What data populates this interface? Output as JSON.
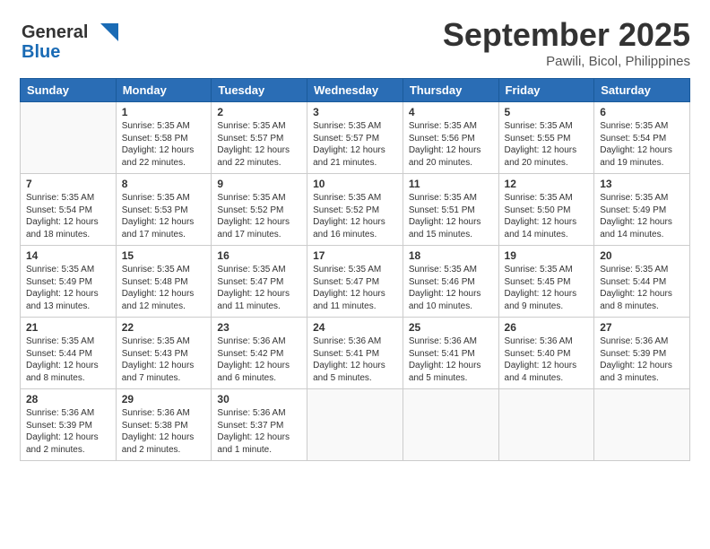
{
  "header": {
    "logo_general": "General",
    "logo_blue": "Blue",
    "main_title": "September 2025",
    "subtitle": "Pawili, Bicol, Philippines"
  },
  "days_of_week": [
    "Sunday",
    "Monday",
    "Tuesday",
    "Wednesday",
    "Thursday",
    "Friday",
    "Saturday"
  ],
  "weeks": [
    [
      {
        "num": "",
        "info": ""
      },
      {
        "num": "1",
        "info": "Sunrise: 5:35 AM\nSunset: 5:58 PM\nDaylight: 12 hours\nand 22 minutes."
      },
      {
        "num": "2",
        "info": "Sunrise: 5:35 AM\nSunset: 5:57 PM\nDaylight: 12 hours\nand 22 minutes."
      },
      {
        "num": "3",
        "info": "Sunrise: 5:35 AM\nSunset: 5:57 PM\nDaylight: 12 hours\nand 21 minutes."
      },
      {
        "num": "4",
        "info": "Sunrise: 5:35 AM\nSunset: 5:56 PM\nDaylight: 12 hours\nand 20 minutes."
      },
      {
        "num": "5",
        "info": "Sunrise: 5:35 AM\nSunset: 5:55 PM\nDaylight: 12 hours\nand 20 minutes."
      },
      {
        "num": "6",
        "info": "Sunrise: 5:35 AM\nSunset: 5:54 PM\nDaylight: 12 hours\nand 19 minutes."
      }
    ],
    [
      {
        "num": "7",
        "info": "Sunrise: 5:35 AM\nSunset: 5:54 PM\nDaylight: 12 hours\nand 18 minutes."
      },
      {
        "num": "8",
        "info": "Sunrise: 5:35 AM\nSunset: 5:53 PM\nDaylight: 12 hours\nand 17 minutes."
      },
      {
        "num": "9",
        "info": "Sunrise: 5:35 AM\nSunset: 5:52 PM\nDaylight: 12 hours\nand 17 minutes."
      },
      {
        "num": "10",
        "info": "Sunrise: 5:35 AM\nSunset: 5:52 PM\nDaylight: 12 hours\nand 16 minutes."
      },
      {
        "num": "11",
        "info": "Sunrise: 5:35 AM\nSunset: 5:51 PM\nDaylight: 12 hours\nand 15 minutes."
      },
      {
        "num": "12",
        "info": "Sunrise: 5:35 AM\nSunset: 5:50 PM\nDaylight: 12 hours\nand 14 minutes."
      },
      {
        "num": "13",
        "info": "Sunrise: 5:35 AM\nSunset: 5:49 PM\nDaylight: 12 hours\nand 14 minutes."
      }
    ],
    [
      {
        "num": "14",
        "info": "Sunrise: 5:35 AM\nSunset: 5:49 PM\nDaylight: 12 hours\nand 13 minutes."
      },
      {
        "num": "15",
        "info": "Sunrise: 5:35 AM\nSunset: 5:48 PM\nDaylight: 12 hours\nand 12 minutes."
      },
      {
        "num": "16",
        "info": "Sunrise: 5:35 AM\nSunset: 5:47 PM\nDaylight: 12 hours\nand 11 minutes."
      },
      {
        "num": "17",
        "info": "Sunrise: 5:35 AM\nSunset: 5:47 PM\nDaylight: 12 hours\nand 11 minutes."
      },
      {
        "num": "18",
        "info": "Sunrise: 5:35 AM\nSunset: 5:46 PM\nDaylight: 12 hours\nand 10 minutes."
      },
      {
        "num": "19",
        "info": "Sunrise: 5:35 AM\nSunset: 5:45 PM\nDaylight: 12 hours\nand 9 minutes."
      },
      {
        "num": "20",
        "info": "Sunrise: 5:35 AM\nSunset: 5:44 PM\nDaylight: 12 hours\nand 8 minutes."
      }
    ],
    [
      {
        "num": "21",
        "info": "Sunrise: 5:35 AM\nSunset: 5:44 PM\nDaylight: 12 hours\nand 8 minutes."
      },
      {
        "num": "22",
        "info": "Sunrise: 5:35 AM\nSunset: 5:43 PM\nDaylight: 12 hours\nand 7 minutes."
      },
      {
        "num": "23",
        "info": "Sunrise: 5:36 AM\nSunset: 5:42 PM\nDaylight: 12 hours\nand 6 minutes."
      },
      {
        "num": "24",
        "info": "Sunrise: 5:36 AM\nSunset: 5:41 PM\nDaylight: 12 hours\nand 5 minutes."
      },
      {
        "num": "25",
        "info": "Sunrise: 5:36 AM\nSunset: 5:41 PM\nDaylight: 12 hours\nand 5 minutes."
      },
      {
        "num": "26",
        "info": "Sunrise: 5:36 AM\nSunset: 5:40 PM\nDaylight: 12 hours\nand 4 minutes."
      },
      {
        "num": "27",
        "info": "Sunrise: 5:36 AM\nSunset: 5:39 PM\nDaylight: 12 hours\nand 3 minutes."
      }
    ],
    [
      {
        "num": "28",
        "info": "Sunrise: 5:36 AM\nSunset: 5:39 PM\nDaylight: 12 hours\nand 2 minutes."
      },
      {
        "num": "29",
        "info": "Sunrise: 5:36 AM\nSunset: 5:38 PM\nDaylight: 12 hours\nand 2 minutes."
      },
      {
        "num": "30",
        "info": "Sunrise: 5:36 AM\nSunset: 5:37 PM\nDaylight: 12 hours\nand 1 minute."
      },
      {
        "num": "",
        "info": ""
      },
      {
        "num": "",
        "info": ""
      },
      {
        "num": "",
        "info": ""
      },
      {
        "num": "",
        "info": ""
      }
    ]
  ]
}
